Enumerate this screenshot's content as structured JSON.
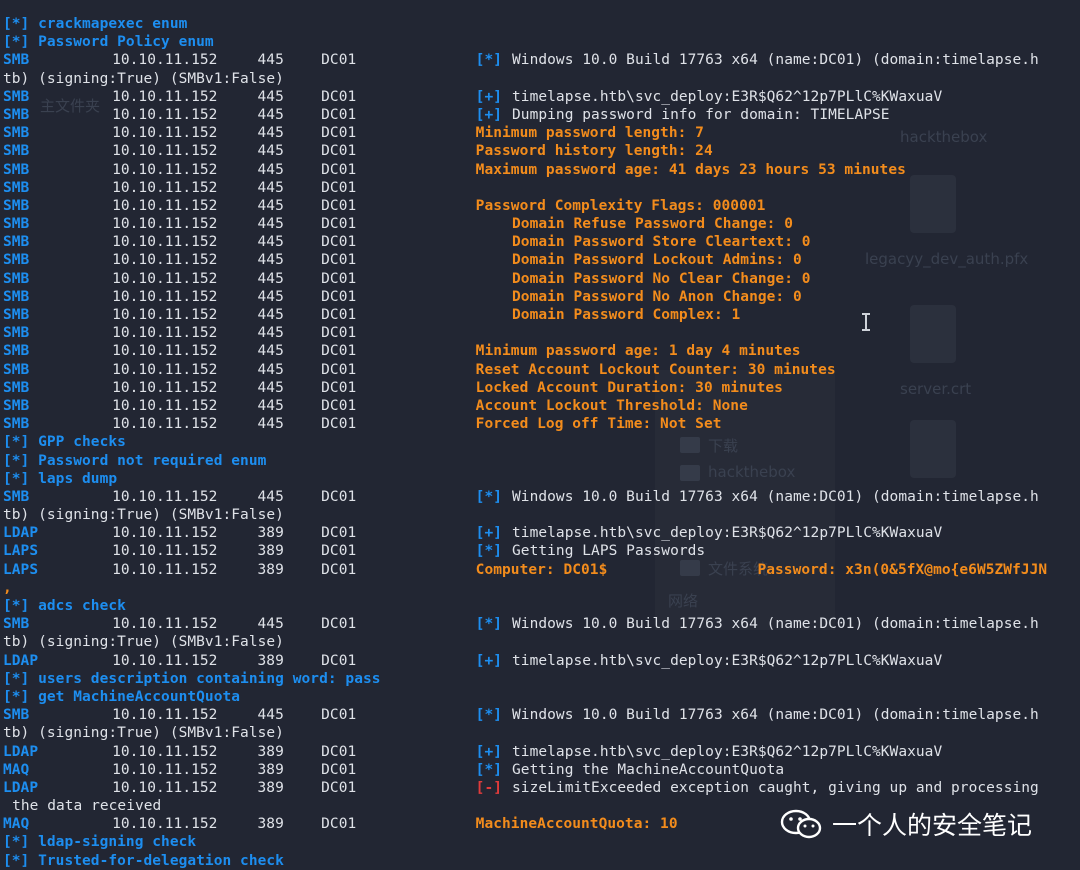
{
  "terminal": {
    "lines": [
      [
        {
          "col": 0,
          "text": "[*] crackmapexec enum",
          "c": "blue"
        }
      ],
      [
        {
          "col": 0,
          "text": "[*] Password Policy enum",
          "c": "blue"
        }
      ],
      [
        {
          "col": 0,
          "text": "SMB",
          "c": "proto"
        },
        {
          "col": 12,
          "text": "10.10.11.152",
          "c": "white"
        },
        {
          "col": 28,
          "text": "445",
          "c": "white"
        },
        {
          "col": 35,
          "text": "DC01",
          "c": "white"
        },
        {
          "col": 52,
          "text": "[*]",
          "c": "blue"
        },
        {
          "col": 56,
          "text": "Windows 10.0 Build 17763 x64 (name:DC01) (domain:timelapse.h",
          "c": "white"
        }
      ],
      [
        {
          "col": 0,
          "text": "tb) (signing:True) (SMBv1:False)",
          "c": "white"
        }
      ],
      [
        {
          "col": 0,
          "text": "SMB",
          "c": "proto"
        },
        {
          "col": 12,
          "text": "10.10.11.152",
          "c": "white"
        },
        {
          "col": 28,
          "text": "445",
          "c": "white"
        },
        {
          "col": 35,
          "text": "DC01",
          "c": "white"
        },
        {
          "col": 52,
          "text": "[+]",
          "c": "blue"
        },
        {
          "col": 56,
          "text": "timelapse.htb\\svc_deploy:E3R$Q62^12p7PLlC%KWaxuaV",
          "c": "white"
        }
      ],
      [
        {
          "col": 0,
          "text": "SMB",
          "c": "proto"
        },
        {
          "col": 12,
          "text": "10.10.11.152",
          "c": "white"
        },
        {
          "col": 28,
          "text": "445",
          "c": "white"
        },
        {
          "col": 35,
          "text": "DC01",
          "c": "white"
        },
        {
          "col": 52,
          "text": "[+]",
          "c": "blue"
        },
        {
          "col": 56,
          "text": "Dumping password info for domain: TIMELAPSE",
          "c": "white"
        }
      ],
      [
        {
          "col": 0,
          "text": "SMB",
          "c": "proto"
        },
        {
          "col": 12,
          "text": "10.10.11.152",
          "c": "white"
        },
        {
          "col": 28,
          "text": "445",
          "c": "white"
        },
        {
          "col": 35,
          "text": "DC01",
          "c": "white"
        },
        {
          "col": 52,
          "text": "Minimum password length: 7",
          "c": "orange"
        }
      ],
      [
        {
          "col": 0,
          "text": "SMB",
          "c": "proto"
        },
        {
          "col": 12,
          "text": "10.10.11.152",
          "c": "white"
        },
        {
          "col": 28,
          "text": "445",
          "c": "white"
        },
        {
          "col": 35,
          "text": "DC01",
          "c": "white"
        },
        {
          "col": 52,
          "text": "Password history length: 24",
          "c": "orange"
        }
      ],
      [
        {
          "col": 0,
          "text": "SMB",
          "c": "proto"
        },
        {
          "col": 12,
          "text": "10.10.11.152",
          "c": "white"
        },
        {
          "col": 28,
          "text": "445",
          "c": "white"
        },
        {
          "col": 35,
          "text": "DC01",
          "c": "white"
        },
        {
          "col": 52,
          "text": "Maximum password age: 41 days 23 hours 53 minutes",
          "c": "orange"
        }
      ],
      [
        {
          "col": 0,
          "text": "SMB",
          "c": "proto"
        },
        {
          "col": 12,
          "text": "10.10.11.152",
          "c": "white"
        },
        {
          "col": 28,
          "text": "445",
          "c": "white"
        },
        {
          "col": 35,
          "text": "DC01",
          "c": "white"
        }
      ],
      [
        {
          "col": 0,
          "text": "SMB",
          "c": "proto"
        },
        {
          "col": 12,
          "text": "10.10.11.152",
          "c": "white"
        },
        {
          "col": 28,
          "text": "445",
          "c": "white"
        },
        {
          "col": 35,
          "text": "DC01",
          "c": "white"
        },
        {
          "col": 52,
          "text": "Password Complexity Flags: 000001",
          "c": "orange"
        }
      ],
      [
        {
          "col": 0,
          "text": "SMB",
          "c": "proto"
        },
        {
          "col": 12,
          "text": "10.10.11.152",
          "c": "white"
        },
        {
          "col": 28,
          "text": "445",
          "c": "white"
        },
        {
          "col": 35,
          "text": "DC01",
          "c": "white"
        },
        {
          "col": 56,
          "text": "Domain Refuse Password Change: 0",
          "c": "orange"
        }
      ],
      [
        {
          "col": 0,
          "text": "SMB",
          "c": "proto"
        },
        {
          "col": 12,
          "text": "10.10.11.152",
          "c": "white"
        },
        {
          "col": 28,
          "text": "445",
          "c": "white"
        },
        {
          "col": 35,
          "text": "DC01",
          "c": "white"
        },
        {
          "col": 56,
          "text": "Domain Password Store Cleartext: 0",
          "c": "orange"
        }
      ],
      [
        {
          "col": 0,
          "text": "SMB",
          "c": "proto"
        },
        {
          "col": 12,
          "text": "10.10.11.152",
          "c": "white"
        },
        {
          "col": 28,
          "text": "445",
          "c": "white"
        },
        {
          "col": 35,
          "text": "DC01",
          "c": "white"
        },
        {
          "col": 56,
          "text": "Domain Password Lockout Admins: 0",
          "c": "orange"
        }
      ],
      [
        {
          "col": 0,
          "text": "SMB",
          "c": "proto"
        },
        {
          "col": 12,
          "text": "10.10.11.152",
          "c": "white"
        },
        {
          "col": 28,
          "text": "445",
          "c": "white"
        },
        {
          "col": 35,
          "text": "DC01",
          "c": "white"
        },
        {
          "col": 56,
          "text": "Domain Password No Clear Change: 0",
          "c": "orange"
        }
      ],
      [
        {
          "col": 0,
          "text": "SMB",
          "c": "proto"
        },
        {
          "col": 12,
          "text": "10.10.11.152",
          "c": "white"
        },
        {
          "col": 28,
          "text": "445",
          "c": "white"
        },
        {
          "col": 35,
          "text": "DC01",
          "c": "white"
        },
        {
          "col": 56,
          "text": "Domain Password No Anon Change: 0",
          "c": "orange"
        }
      ],
      [
        {
          "col": 0,
          "text": "SMB",
          "c": "proto"
        },
        {
          "col": 12,
          "text": "10.10.11.152",
          "c": "white"
        },
        {
          "col": 28,
          "text": "445",
          "c": "white"
        },
        {
          "col": 35,
          "text": "DC01",
          "c": "white"
        },
        {
          "col": 56,
          "text": "Domain Password Complex: 1",
          "c": "orange"
        }
      ],
      [
        {
          "col": 0,
          "text": "SMB",
          "c": "proto"
        },
        {
          "col": 12,
          "text": "10.10.11.152",
          "c": "white"
        },
        {
          "col": 28,
          "text": "445",
          "c": "white"
        },
        {
          "col": 35,
          "text": "DC01",
          "c": "white"
        }
      ],
      [
        {
          "col": 0,
          "text": "SMB",
          "c": "proto"
        },
        {
          "col": 12,
          "text": "10.10.11.152",
          "c": "white"
        },
        {
          "col": 28,
          "text": "445",
          "c": "white"
        },
        {
          "col": 35,
          "text": "DC01",
          "c": "white"
        },
        {
          "col": 52,
          "text": "Minimum password age: 1 day 4 minutes",
          "c": "orange"
        }
      ],
      [
        {
          "col": 0,
          "text": "SMB",
          "c": "proto"
        },
        {
          "col": 12,
          "text": "10.10.11.152",
          "c": "white"
        },
        {
          "col": 28,
          "text": "445",
          "c": "white"
        },
        {
          "col": 35,
          "text": "DC01",
          "c": "white"
        },
        {
          "col": 52,
          "text": "Reset Account Lockout Counter: 30 minutes",
          "c": "orange"
        }
      ],
      [
        {
          "col": 0,
          "text": "SMB",
          "c": "proto"
        },
        {
          "col": 12,
          "text": "10.10.11.152",
          "c": "white"
        },
        {
          "col": 28,
          "text": "445",
          "c": "white"
        },
        {
          "col": 35,
          "text": "DC01",
          "c": "white"
        },
        {
          "col": 52,
          "text": "Locked Account Duration: 30 minutes",
          "c": "orange"
        }
      ],
      [
        {
          "col": 0,
          "text": "SMB",
          "c": "proto"
        },
        {
          "col": 12,
          "text": "10.10.11.152",
          "c": "white"
        },
        {
          "col": 28,
          "text": "445",
          "c": "white"
        },
        {
          "col": 35,
          "text": "DC01",
          "c": "white"
        },
        {
          "col": 52,
          "text": "Account Lockout Threshold: None",
          "c": "orange"
        }
      ],
      [
        {
          "col": 0,
          "text": "SMB",
          "c": "proto"
        },
        {
          "col": 12,
          "text": "10.10.11.152",
          "c": "white"
        },
        {
          "col": 28,
          "text": "445",
          "c": "white"
        },
        {
          "col": 35,
          "text": "DC01",
          "c": "white"
        },
        {
          "col": 52,
          "text": "Forced Log off Time: Not Set",
          "c": "orange"
        }
      ],
      [
        {
          "col": 0,
          "text": "[*] GPP checks",
          "c": "blue"
        }
      ],
      [
        {
          "col": 0,
          "text": "[*] Password not required enum",
          "c": "blue"
        }
      ],
      [
        {
          "col": 0,
          "text": "[*] laps dump",
          "c": "blue"
        }
      ],
      [
        {
          "col": 0,
          "text": "SMB",
          "c": "proto"
        },
        {
          "col": 12,
          "text": "10.10.11.152",
          "c": "white"
        },
        {
          "col": 28,
          "text": "445",
          "c": "white"
        },
        {
          "col": 35,
          "text": "DC01",
          "c": "white"
        },
        {
          "col": 52,
          "text": "[*]",
          "c": "blue"
        },
        {
          "col": 56,
          "text": "Windows 10.0 Build 17763 x64 (name:DC01) (domain:timelapse.h",
          "c": "white"
        }
      ],
      [
        {
          "col": 0,
          "text": "tb) (signing:True) (SMBv1:False)",
          "c": "white"
        }
      ],
      [
        {
          "col": 0,
          "text": "LDAP",
          "c": "proto"
        },
        {
          "col": 12,
          "text": "10.10.11.152",
          "c": "white"
        },
        {
          "col": 28,
          "text": "389",
          "c": "white"
        },
        {
          "col": 35,
          "text": "DC01",
          "c": "white"
        },
        {
          "col": 52,
          "text": "[+]",
          "c": "blue"
        },
        {
          "col": 56,
          "text": "timelapse.htb\\svc_deploy:E3R$Q62^12p7PLlC%KWaxuaV",
          "c": "white"
        }
      ],
      [
        {
          "col": 0,
          "text": "LAPS",
          "c": "proto"
        },
        {
          "col": 12,
          "text": "10.10.11.152",
          "c": "white"
        },
        {
          "col": 28,
          "text": "389",
          "c": "white"
        },
        {
          "col": 35,
          "text": "DC01",
          "c": "white"
        },
        {
          "col": 52,
          "text": "[*]",
          "c": "blue"
        },
        {
          "col": 56,
          "text": "Getting LAPS Passwords",
          "c": "white"
        }
      ],
      [
        {
          "col": 0,
          "text": "LAPS",
          "c": "proto"
        },
        {
          "col": 12,
          "text": "10.10.11.152",
          "c": "white"
        },
        {
          "col": 28,
          "text": "389",
          "c": "white"
        },
        {
          "col": 35,
          "text": "DC01",
          "c": "white"
        },
        {
          "col": 52,
          "text": "Computer: DC01$",
          "c": "orange"
        },
        {
          "col": 83,
          "text": "Password: x3n(0&5fX@mo{e6W5ZWfJJN",
          "c": "orange"
        }
      ],
      [
        {
          "col": 0,
          "text": ",",
          "c": "orange"
        }
      ],
      [
        {
          "col": 0,
          "text": "[*] adcs check",
          "c": "blue"
        }
      ],
      [
        {
          "col": 0,
          "text": "SMB",
          "c": "proto"
        },
        {
          "col": 12,
          "text": "10.10.11.152",
          "c": "white"
        },
        {
          "col": 28,
          "text": "445",
          "c": "white"
        },
        {
          "col": 35,
          "text": "DC01",
          "c": "white"
        },
        {
          "col": 52,
          "text": "[*]",
          "c": "blue"
        },
        {
          "col": 56,
          "text": "Windows 10.0 Build 17763 x64 (name:DC01) (domain:timelapse.h",
          "c": "white"
        }
      ],
      [
        {
          "col": 0,
          "text": "tb) (signing:True) (SMBv1:False)",
          "c": "white"
        }
      ],
      [
        {
          "col": 0,
          "text": "LDAP",
          "c": "proto"
        },
        {
          "col": 12,
          "text": "10.10.11.152",
          "c": "white"
        },
        {
          "col": 28,
          "text": "389",
          "c": "white"
        },
        {
          "col": 35,
          "text": "DC01",
          "c": "white"
        },
        {
          "col": 52,
          "text": "[+]",
          "c": "blue"
        },
        {
          "col": 56,
          "text": "timelapse.htb\\svc_deploy:E3R$Q62^12p7PLlC%KWaxuaV",
          "c": "white"
        }
      ],
      [
        {
          "col": 0,
          "text": "[*] users description containing word: pass",
          "c": "blue"
        }
      ],
      [
        {
          "col": 0,
          "text": "[*] get MachineAccountQuota",
          "c": "blue"
        }
      ],
      [
        {
          "col": 0,
          "text": "SMB",
          "c": "proto"
        },
        {
          "col": 12,
          "text": "10.10.11.152",
          "c": "white"
        },
        {
          "col": 28,
          "text": "445",
          "c": "white"
        },
        {
          "col": 35,
          "text": "DC01",
          "c": "white"
        },
        {
          "col": 52,
          "text": "[*]",
          "c": "blue"
        },
        {
          "col": 56,
          "text": "Windows 10.0 Build 17763 x64 (name:DC01) (domain:timelapse.h",
          "c": "white"
        }
      ],
      [
        {
          "col": 0,
          "text": "tb) (signing:True) (SMBv1:False)",
          "c": "white"
        }
      ],
      [
        {
          "col": 0,
          "text": "LDAP",
          "c": "proto"
        },
        {
          "col": 12,
          "text": "10.10.11.152",
          "c": "white"
        },
        {
          "col": 28,
          "text": "389",
          "c": "white"
        },
        {
          "col": 35,
          "text": "DC01",
          "c": "white"
        },
        {
          "col": 52,
          "text": "[+]",
          "c": "blue"
        },
        {
          "col": 56,
          "text": "timelapse.htb\\svc_deploy:E3R$Q62^12p7PLlC%KWaxuaV",
          "c": "white"
        }
      ],
      [
        {
          "col": 0,
          "text": "MAQ",
          "c": "proto"
        },
        {
          "col": 12,
          "text": "10.10.11.152",
          "c": "white"
        },
        {
          "col": 28,
          "text": "389",
          "c": "white"
        },
        {
          "col": 35,
          "text": "DC01",
          "c": "white"
        },
        {
          "col": 52,
          "text": "[*]",
          "c": "blue"
        },
        {
          "col": 56,
          "text": "Getting the MachineAccountQuota",
          "c": "white"
        }
      ],
      [
        {
          "col": 0,
          "text": "LDAP",
          "c": "proto"
        },
        {
          "col": 12,
          "text": "10.10.11.152",
          "c": "white"
        },
        {
          "col": 28,
          "text": "389",
          "c": "white"
        },
        {
          "col": 35,
          "text": "DC01",
          "c": "white"
        },
        {
          "col": 52,
          "text": "[-]",
          "c": "red"
        },
        {
          "col": 56,
          "text": "sizeLimitExceeded exception caught, giving up and processing",
          "c": "white"
        }
      ],
      [
        {
          "col": 1,
          "text": "the data received",
          "c": "white"
        }
      ],
      [
        {
          "col": 0,
          "text": "MAQ",
          "c": "proto"
        },
        {
          "col": 12,
          "text": "10.10.11.152",
          "c": "white"
        },
        {
          "col": 28,
          "text": "389",
          "c": "white"
        },
        {
          "col": 35,
          "text": "DC01",
          "c": "white"
        },
        {
          "col": 52,
          "text": "MachineAccountQuota: 10",
          "c": "orange"
        }
      ],
      [
        {
          "col": 0,
          "text": "[*] ldap-signing check",
          "c": "blue"
        }
      ],
      [
        {
          "col": 0,
          "text": "[*] Trusted-for-delegation check",
          "c": "blue"
        }
      ]
    ]
  },
  "background_window": {
    "labels": [
      "主文件夹",
      "hackthebox",
      "legacyy_dev_auth.pfx",
      "server.crt",
      "下载",
      "hackthebox",
      "文件系统",
      "网络"
    ],
    "file_icon": "document-icon"
  },
  "watermark": {
    "text": "一个人的安全笔记",
    "icon": "wechat-icon"
  },
  "cursor": {
    "icon": "text-cursor-icon"
  },
  "colors": {
    "background": "#222633",
    "blue": "#1d8ef0",
    "white": "#dfe2e8",
    "orange": "#f38c1c",
    "red": "#e03b3b"
  }
}
